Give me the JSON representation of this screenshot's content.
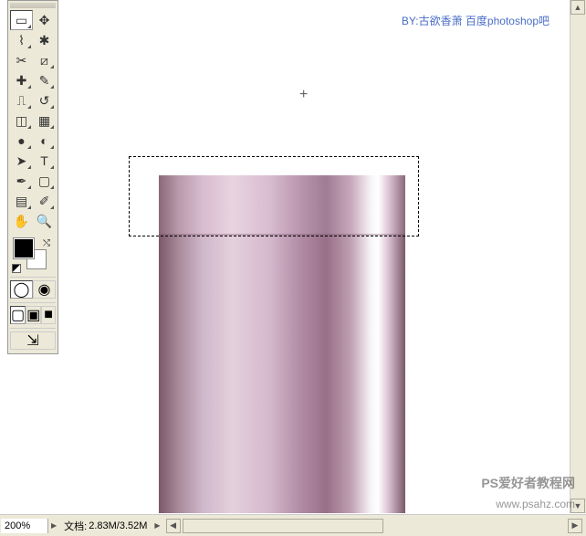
{
  "credit": "BY:古欲香萧   百度photoshop吧",
  "tools": [
    {
      "name": "marquee-tool",
      "glyph": "▭",
      "selected": true,
      "tri": true
    },
    {
      "name": "move-tool",
      "glyph": "✥",
      "tri": false
    },
    {
      "name": "lasso-tool",
      "glyph": "⌇",
      "tri": true
    },
    {
      "name": "magic-wand-tool",
      "glyph": "✱",
      "tri": false
    },
    {
      "name": "crop-tool",
      "glyph": "✂",
      "tri": false
    },
    {
      "name": "slice-tool",
      "glyph": "⧄",
      "tri": true
    },
    {
      "name": "healing-tool",
      "glyph": "✚",
      "tri": true
    },
    {
      "name": "brush-tool",
      "glyph": "✎",
      "tri": true
    },
    {
      "name": "stamp-tool",
      "glyph": "⎍",
      "tri": true
    },
    {
      "name": "history-brush-tool",
      "glyph": "↺",
      "tri": true
    },
    {
      "name": "eraser-tool",
      "glyph": "◫",
      "tri": true
    },
    {
      "name": "gradient-tool",
      "glyph": "▦",
      "tri": true
    },
    {
      "name": "blur-tool",
      "glyph": "●",
      "tri": true
    },
    {
      "name": "dodge-tool",
      "glyph": "◐",
      "tri": true
    },
    {
      "name": "path-select-tool",
      "glyph": "➤",
      "tri": true
    },
    {
      "name": "type-tool",
      "glyph": "T",
      "tri": true
    },
    {
      "name": "pen-tool",
      "glyph": "✒",
      "tri": true
    },
    {
      "name": "shape-tool",
      "glyph": "▢",
      "tri": true
    },
    {
      "name": "notes-tool",
      "glyph": "▤",
      "tri": true
    },
    {
      "name": "eyedropper-tool",
      "glyph": "✐",
      "tri": true
    },
    {
      "name": "hand-tool",
      "glyph": "✋",
      "tri": false
    },
    {
      "name": "zoom-tool",
      "glyph": "🔍",
      "tri": false
    }
  ],
  "colors": {
    "fg": "#000000",
    "bg": "#ffffff"
  },
  "status": {
    "zoom": "200%",
    "doc_label": "文档:",
    "doc_value": "2.83M/3.52M"
  },
  "watermark": {
    "line1": "PS爱好者教程网",
    "line2": "www.psahz.com"
  }
}
